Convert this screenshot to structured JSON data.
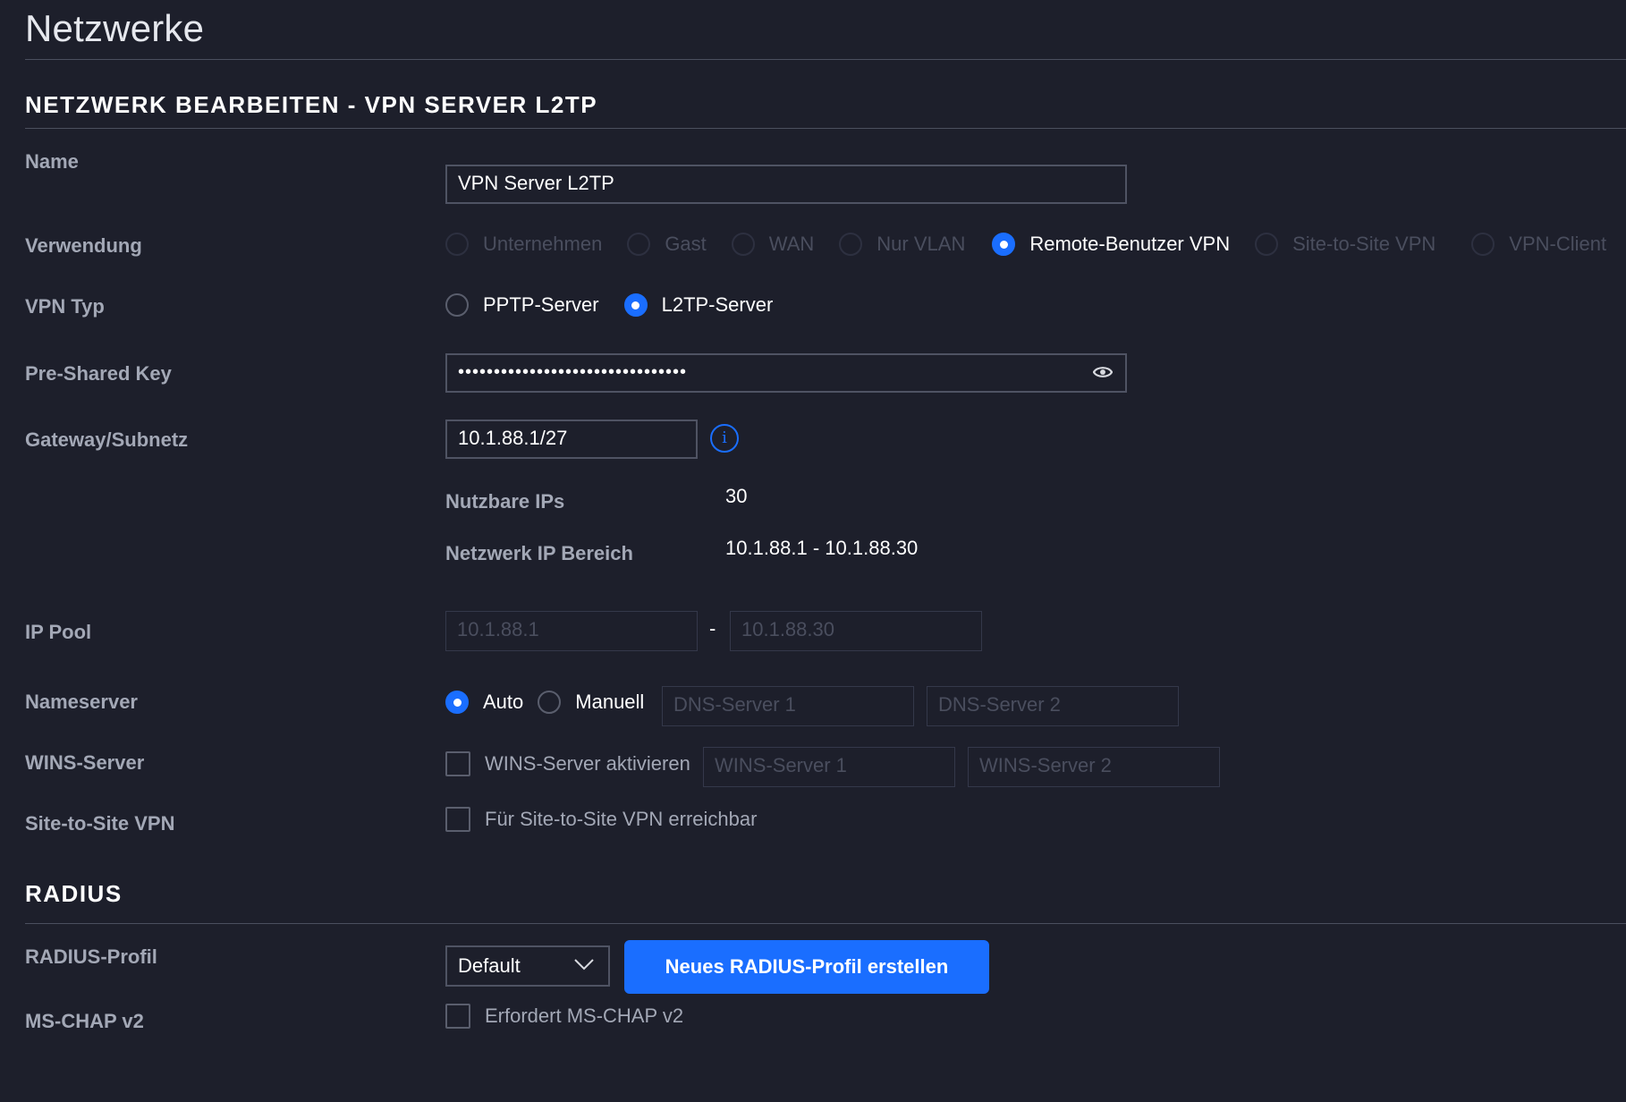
{
  "page": {
    "title": "Netzwerke"
  },
  "edit_section": {
    "title": "NETZWERK BEARBEITEN - VPN SERVER L2TP",
    "name": {
      "label": "Name",
      "value": "VPN Server L2TP"
    },
    "usage": {
      "label": "Verwendung",
      "options": [
        "Unternehmen",
        "Gast",
        "WAN",
        "Nur VLAN",
        "Remote-Benutzer VPN",
        "Site-to-Site VPN",
        "VPN-Client"
      ],
      "selected": "Remote-Benutzer VPN"
    },
    "vpn_type": {
      "label": "VPN Typ",
      "options": [
        "PPTP-Server",
        "L2TP-Server"
      ],
      "selected": "L2TP-Server"
    },
    "psk": {
      "label": "Pre-Shared Key",
      "value": "••••••••••••••••••••••••••••••••",
      "icon": "eye-icon"
    },
    "gateway": {
      "label": "Gateway/Subnetz",
      "value": "10.1.88.1/27",
      "icon": "info-icon",
      "info_glyph": "i"
    },
    "usable_ips": {
      "label": "Nutzbare IPs",
      "value": "30"
    },
    "ip_range": {
      "label": "Netzwerk IP Bereich",
      "value": "10.1.88.1 - 10.1.88.30"
    },
    "ip_pool": {
      "label": "IP Pool",
      "start": "10.1.88.1",
      "separator": "-",
      "end": "10.1.88.30"
    },
    "nameserver": {
      "label": "Nameserver",
      "options": [
        "Auto",
        "Manuell"
      ],
      "selected": "Auto",
      "dns1_placeholder": "DNS-Server 1",
      "dns2_placeholder": "DNS-Server 2"
    },
    "wins": {
      "label": "WINS-Server",
      "checkbox_label": "WINS-Server aktivieren",
      "checked": false,
      "wins1_placeholder": "WINS-Server 1",
      "wins2_placeholder": "WINS-Server 2"
    },
    "site_to_site": {
      "label": "Site-to-Site VPN",
      "checkbox_label": "Für Site-to-Site VPN erreichbar",
      "checked": false
    }
  },
  "radius_section": {
    "title": "RADIUS",
    "profile": {
      "label": "RADIUS-Profil",
      "selected": "Default",
      "create_button": "Neues RADIUS-Profil erstellen"
    },
    "mschap": {
      "label": "MS-CHAP v2",
      "checkbox_label": "Erfordert MS-CHAP v2",
      "checked": false
    }
  },
  "colors": {
    "accent": "#1a6eff",
    "background": "#1d1f2b",
    "label": "#a3a8b6"
  }
}
